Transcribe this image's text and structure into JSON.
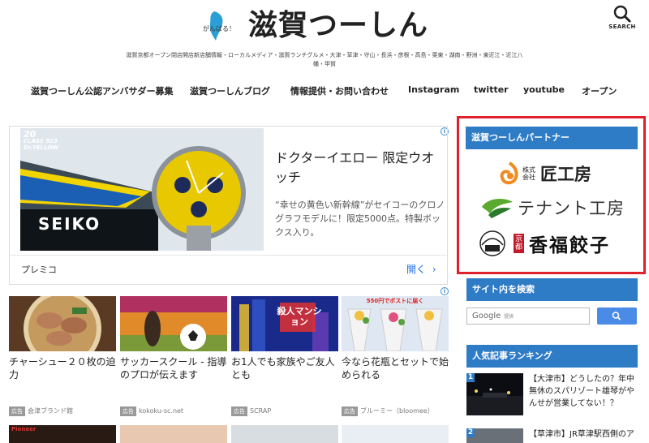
{
  "header": {
    "logo_small": "がんばる！",
    "logo_text": "滋賀つーしん",
    "search_label": "SEARCH",
    "tagline": "滋賀京都オープン閉店開店新店舗情報・ローカルメディア・滋賀ランチグルメ・大津・草津・守山・長浜・彦根・高島・栗東・湖南・野洲・東近江・近江八幡・甲賀"
  },
  "nav": {
    "items": [
      "滋賀つーしん公認アンバサダー募集",
      "滋賀つーしんブログ",
      "情報提供・お問い合わせ",
      "Instagram",
      "twitter",
      "youtube",
      "オープン"
    ]
  },
  "ad": {
    "image_badge": "20",
    "image_class": "CLASS 923",
    "image_model": "Dr.YELLOW",
    "image_brand": "SEIKO",
    "headline": "ドクターイエロー 限定ウオッチ",
    "description": "“幸せの黄色い新幹線”がセイコーのクロノグラフモデルに！限定5000点。特製ボックス入り。",
    "sponsor": "プレミコ",
    "open_label": "開く",
    "adchoice": "i"
  },
  "articles": [
    {
      "title": "チャーシュー２０枚の迫力",
      "ad_label": "広告",
      "source": "会津ブランド館",
      "thumb_color": "#8a5a36"
    },
    {
      "title": "サッカースクール - 指導のプロが伝えます",
      "ad_label": "広告",
      "source": "kokoku-sc.net",
      "thumb_color": "#c9832e"
    },
    {
      "title": "お1人でも家族やご友人とも",
      "ad_label": "広告",
      "source": "SCRAP",
      "thumb_color": "#2a3fa8",
      "thumb_text": "殺人マンション"
    },
    {
      "title": "今なら花瓶とセットで始められる",
      "ad_label": "広告",
      "source": "ブルーミー（bloomee）",
      "thumb_color": "#c8d6e8",
      "thumb_text": "550円でポストに届く"
    }
  ],
  "sidebar": {
    "partner_heading": "滋賀つーしんパートナー",
    "partners": [
      {
        "prefix": "株式会社",
        "name": "匠工房"
      },
      {
        "prefix": "",
        "name": "テナント工房"
      },
      {
        "prefix": "京都",
        "name": "香福餃子"
      }
    ],
    "search_heading": "サイト内を検索",
    "search_placeholder": "Google",
    "search_powered": "提供",
    "ranking_heading": "人気記事ランキング",
    "ranking": [
      {
        "rank": "1",
        "text": "【大津市】どうしたの？年中無休のスパリゾート雄琴がやんせが営業してない！？"
      },
      {
        "rank": "2",
        "text": "【草津市】JR草津駅西側のア"
      }
    ]
  },
  "colors": {
    "accent": "#2e7bc6",
    "highlight_frame": "#e0202a",
    "link": "#1a73e8"
  }
}
